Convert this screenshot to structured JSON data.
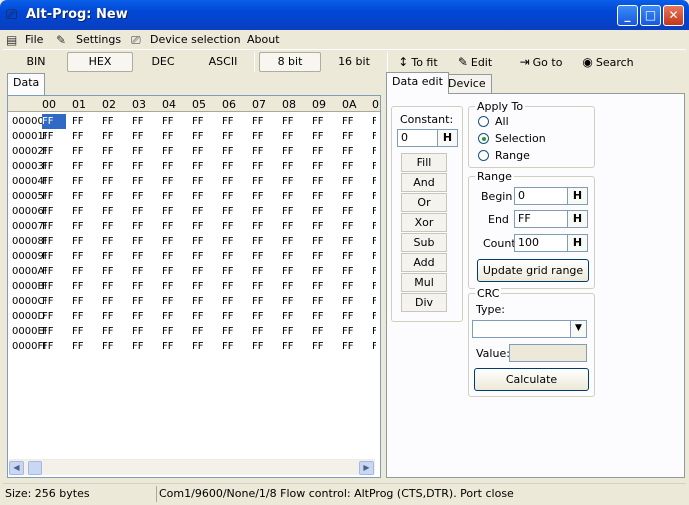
{
  "window": {
    "title": "Alt-Prog: New",
    "controls": [
      "minimize",
      "maximize",
      "close"
    ]
  },
  "menu": {
    "file": "File",
    "settings": "Settings",
    "device_selection": "Device selection",
    "about": "About"
  },
  "toolbar": {
    "modes": [
      "BIN",
      "HEX",
      "DEC",
      "ASCII"
    ],
    "selected_mode": "HEX",
    "widths": [
      "8 bit",
      "16 bit"
    ],
    "selected_width": "8 bit",
    "to_fit": "To fit",
    "edit": "Edit",
    "go_to": "Go to",
    "search": "Search"
  },
  "left_tabs": {
    "data": "Data"
  },
  "grid": {
    "columns": [
      "00",
      "01",
      "02",
      "03",
      "04",
      "05",
      "06",
      "07",
      "08",
      "09",
      "0A",
      "0"
    ],
    "rows": [
      "00000FF",
      "00001FF",
      "00002FF",
      "00003FF",
      "00004FF",
      "00005FF",
      "00006FF",
      "00007FF",
      "00008FF",
      "00009FF",
      "0000AFF",
      "0000BFF",
      "0000CFF",
      "0000DFF",
      "0000EFF",
      "0000FFF"
    ],
    "cell_value": "FF",
    "selected_cell": "row 0, col 0"
  },
  "right_tabs": {
    "data_edit": "Data edit",
    "device": "Device"
  },
  "constant": {
    "label": "Constant:",
    "value": "0",
    "h": "H"
  },
  "ops": [
    "Fill",
    "And",
    "Or",
    "Xor",
    "Sub",
    "Add",
    "Mul",
    "Div"
  ],
  "apply_to": {
    "label": "Apply To",
    "options": [
      "All",
      "Selection",
      "Range"
    ],
    "selected": "Selection"
  },
  "range": {
    "label": "Range",
    "begin_label": "Begin",
    "begin_value": "0",
    "end_label": "End",
    "end_value": "FF",
    "count_label": "Count",
    "count_value": "100",
    "h": "H",
    "update_button": "Update grid range"
  },
  "crc": {
    "label": "CRC",
    "type_label": "Type:",
    "type_value": "",
    "value_label": "Value:",
    "value": "",
    "calculate_button": "Calculate"
  },
  "status": {
    "size": "Size: 256 bytes",
    "port": "Com1/9600/None/1/8  Flow control: AltProg (CTS,DTR). Port close"
  }
}
